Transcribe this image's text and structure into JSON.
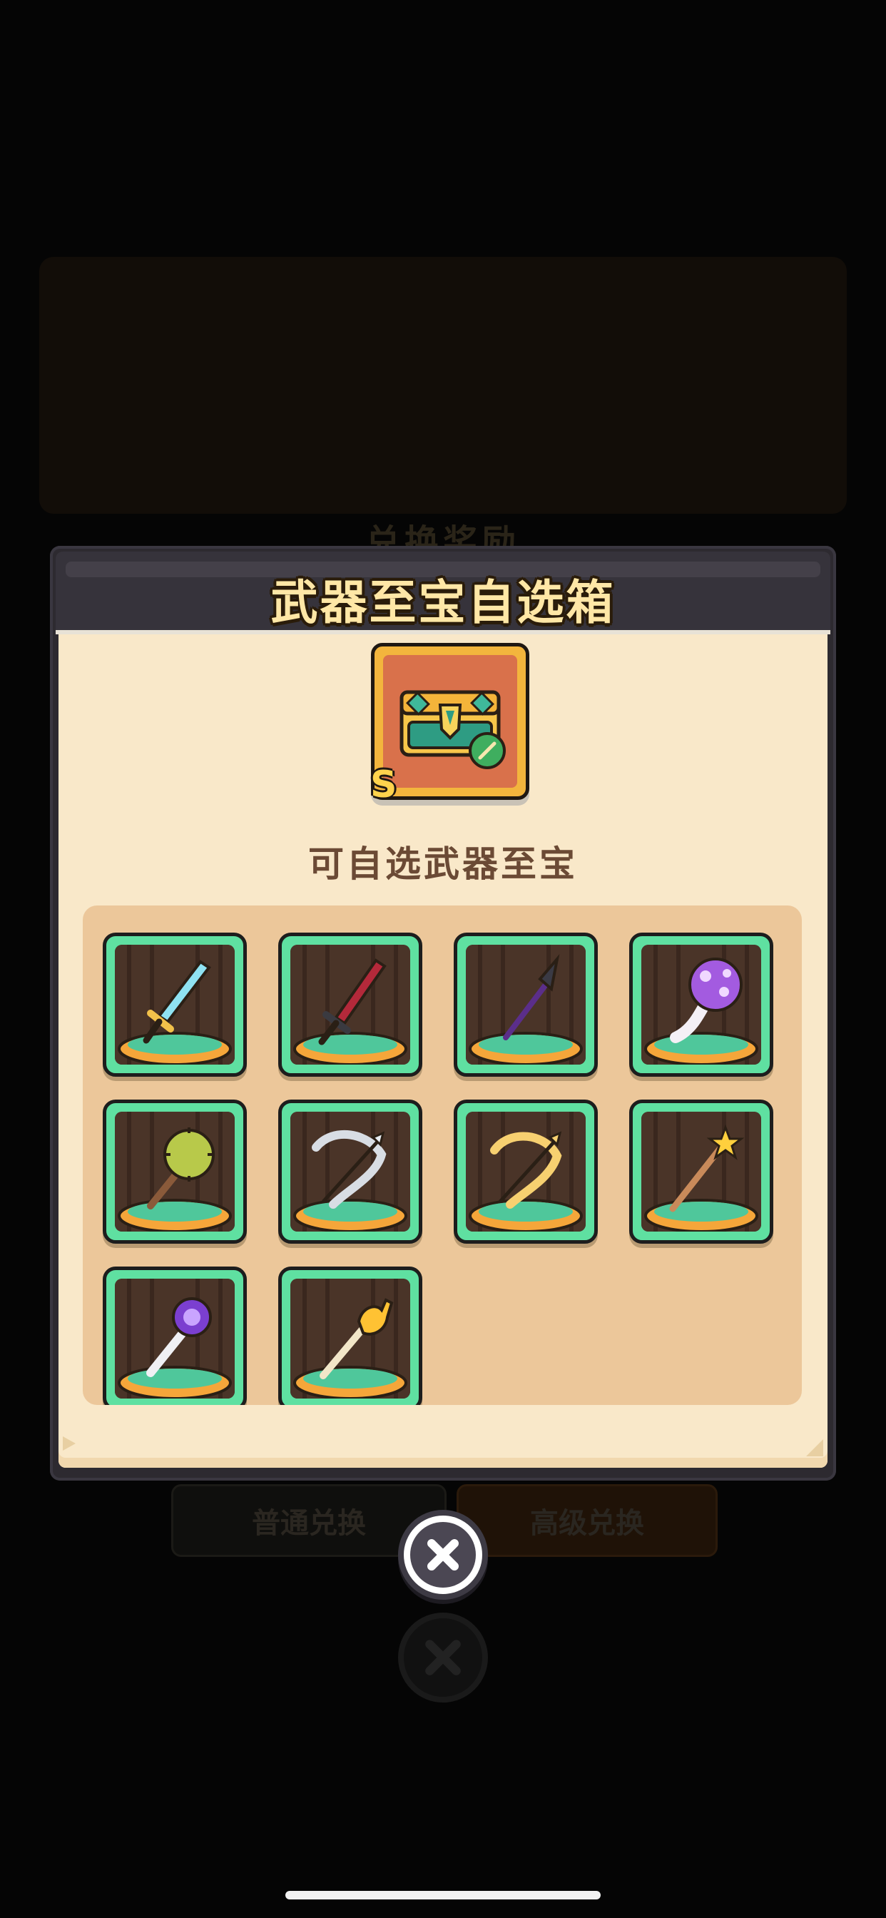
{
  "background": {
    "section_title": "兑换奖励",
    "buttons": {
      "normal_exchange": "普通兑换",
      "premium_exchange": "高级兑换"
    }
  },
  "modal": {
    "title": "武器至宝自选箱",
    "chest": {
      "grade": "S",
      "icon": "treasure-chest-icon"
    },
    "subtitle": "可自选武器至宝",
    "items": [
      {
        "icon": "crystal-sword-icon"
      },
      {
        "icon": "crimson-sword-icon"
      },
      {
        "icon": "dark-spear-icon"
      },
      {
        "icon": "purple-spiked-mace-icon"
      },
      {
        "icon": "thorn-club-icon"
      },
      {
        "icon": "silver-bow-icon"
      },
      {
        "icon": "golden-bow-icon"
      },
      {
        "icon": "star-staff-icon"
      },
      {
        "icon": "amethyst-scepter-icon"
      },
      {
        "icon": "golden-hand-staff-icon"
      }
    ]
  },
  "close_button": {
    "icon": "close-icon"
  },
  "colors": {
    "title_text": "#ffe7a6",
    "body_bg": "#f9e8c9",
    "panel_bg": "#ecc79a",
    "slot_green": "#5fe0a1",
    "subtitle_text": "#6b4a35"
  }
}
